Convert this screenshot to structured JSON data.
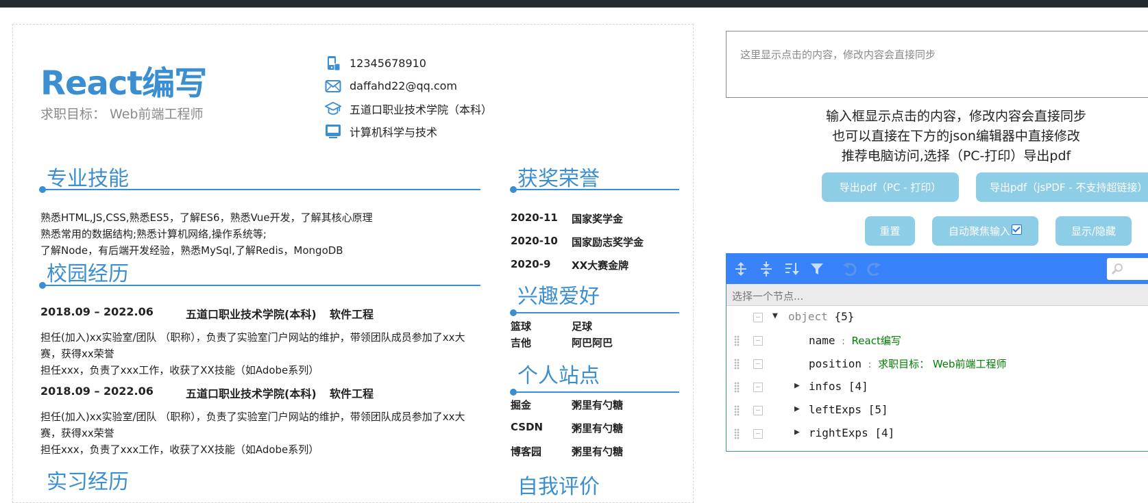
{
  "resume": {
    "name": "React编写",
    "position": "求职目标：  Web前端工程师",
    "infos": [
      {
        "icon": "phone-icon",
        "text": "12345678910"
      },
      {
        "icon": "mail-icon",
        "text": "daffahd22@qq.com"
      },
      {
        "icon": "graduation-cap-icon",
        "text": "五道口职业技术学院（本科）"
      },
      {
        "icon": "laptop-icon",
        "text": "计算机科学与技术"
      }
    ],
    "sections": {
      "skills": "专业技能",
      "campus": "校园经历",
      "internship": "实习经历",
      "awards": "获奖荣誉",
      "hobbies": "兴趣爱好",
      "sites": "个人站点",
      "evaluation": "自我评价"
    },
    "skills": [
      "熟悉HTML,JS,CSS,熟悉ES5，了解ES6，熟悉Vue开发，了解其核心原理",
      "熟悉常用的数据结构;熟悉计算机网络,操作系统等;",
      "了解Node，有后端开发经验，熟悉MySql,了解Redis，MongoDB"
    ],
    "experiences": [
      {
        "date": "2018.09 – 2022.06",
        "school": "五道口职业技术学院(本科)",
        "major": "软件工程",
        "desc": [
          "担任(加入)xx实验室/团队 （职称），负责了实验室门户网站的维护，带领团队成员参加了xx大赛，获得xx荣誉",
          "担任xxx，负责了xxx工作，收获了XX技能（如Adobe系列）"
        ]
      },
      {
        "date": "2018.09 – 2022.06",
        "school": "五道口职业技术学院(本科)",
        "major": "软件工程",
        "desc": [
          "担任(加入)xx实验室/团队 （职称），负责了实验室门户网站的维护，带领团队成员参加了xx大赛，获得xx荣誉",
          "担任xxx，负责了xxx工作，收获了XX技能（如Adobe系列）"
        ]
      }
    ],
    "awards": [
      {
        "date": "2020-11",
        "name": "国家奖学金"
      },
      {
        "date": "2020-10",
        "name": "国家励志奖学金"
      },
      {
        "date": "2020-9",
        "name": "XX大赛金牌"
      }
    ],
    "hobbies": [
      [
        "篮球",
        "足球"
      ],
      [
        "吉他",
        "阿巴阿巴"
      ]
    ],
    "sites": [
      {
        "site": "掘金",
        "name": "粥里有勺糖"
      },
      {
        "site": "CSDN",
        "name": "粥里有勺糖"
      },
      {
        "site": "博客园",
        "name": "粥里有勺糖"
      }
    ]
  },
  "panel": {
    "placeholder": "这里显示点击的内容，修改内容会直接同步",
    "hints": [
      "输入框显示点击的内容，修改内容会直接同步",
      "也可以直接在下方的json编辑器中直接修改",
      "推荐电脑访问,选择（PC-打印）导出pdf"
    ],
    "buttons": {
      "export_pc": "导出pdf（PC - 打印）",
      "export_jspdf": "导出pdf（jsPDF - 不支持超链接）",
      "reset": "重置",
      "autofocus": "自动聚焦输入",
      "toggle": "显示/隐藏"
    },
    "autofocus_checked": true,
    "accent": "#3883fa",
    "button_color": "#8ecde6",
    "resume_color": "#3b8fd0"
  },
  "editor": {
    "navbar_placeholder": "选择一个节点...",
    "root": {
      "type": "object",
      "count": "{5}"
    },
    "rows": [
      {
        "key": "name",
        "value": "React编写"
      },
      {
        "key": "position",
        "value": "求职目标：  Web前端工程师"
      },
      {
        "key": "infos",
        "count": "[4]"
      },
      {
        "key": "leftExps",
        "count": "[5]"
      },
      {
        "key": "rightExps",
        "count": "[4]"
      }
    ],
    "toolbar_icons": [
      "expand-all-icon",
      "collapse-all-icon",
      "sort-icon",
      "filter-icon",
      "undo-icon",
      "redo-icon",
      "search-icon"
    ]
  }
}
